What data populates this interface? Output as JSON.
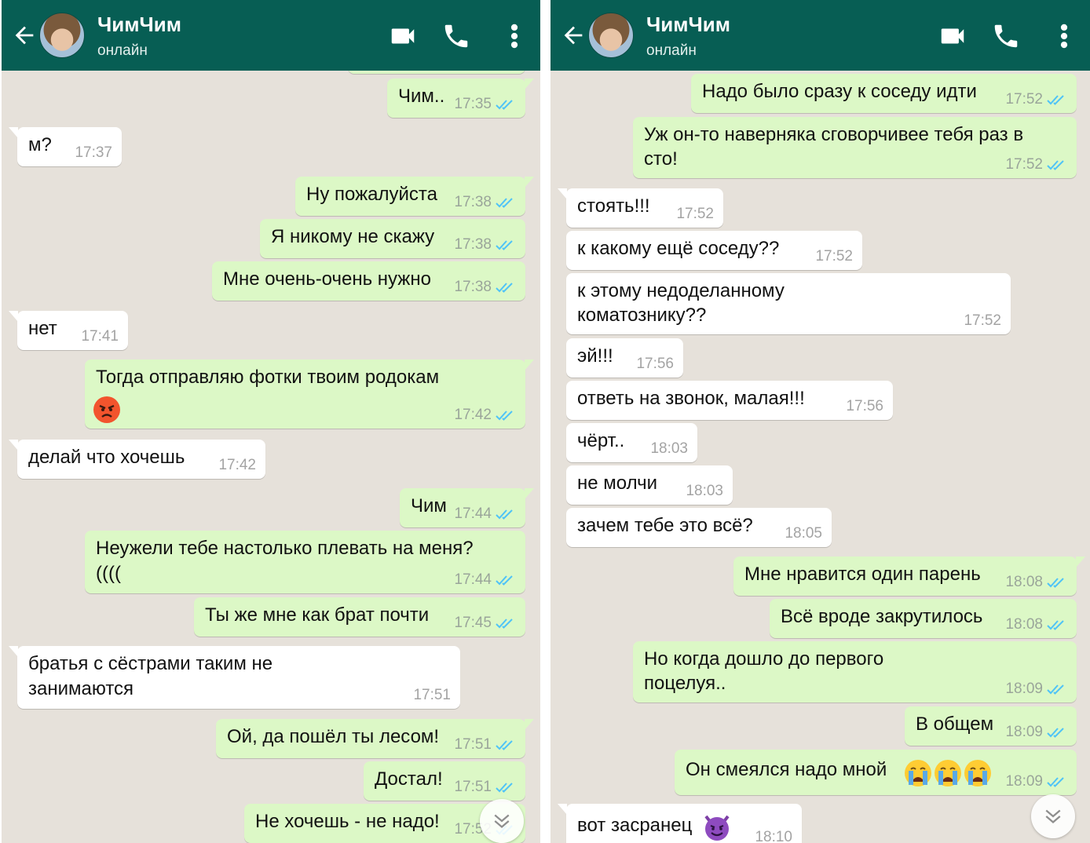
{
  "contact": {
    "name": "ЧимЧим",
    "status": "онлайн"
  },
  "left_messages": [
    {
      "dir": "out",
      "text": "Чим..",
      "time": "17:35"
    },
    {
      "dir": "in",
      "text": "м?",
      "time": "17:37"
    },
    {
      "dir": "out",
      "text": "Ну пожалуйста",
      "time": "17:38"
    },
    {
      "dir": "out",
      "text": "Я никому не скажу",
      "time": "17:38"
    },
    {
      "dir": "out",
      "text": "Мне очень-очень нужно",
      "time": "17:38"
    },
    {
      "dir": "in",
      "text": "нет",
      "time": "17:41"
    },
    {
      "dir": "out",
      "text": "Тогда отправляю фотки твоим родокам",
      "emoji": "angry-face",
      "time": "17:42"
    },
    {
      "dir": "in",
      "text": "делай что хочешь",
      "time": "17:42"
    },
    {
      "dir": "out",
      "text": "Чим",
      "time": "17:44"
    },
    {
      "dir": "out",
      "text": "Неужели тебе настолько плевать на меня?",
      "text2": "((((",
      "time": "17:44"
    },
    {
      "dir": "out",
      "text": "Ты же мне как брат почти",
      "time": "17:45"
    },
    {
      "dir": "in",
      "text": "братья с сёстрами таким не",
      "text2": "занимаются",
      "time": "17:51"
    },
    {
      "dir": "out",
      "text": "Ой, да пошёл ты лесом!",
      "time": "17:51"
    },
    {
      "dir": "out",
      "text": "Достал!",
      "time": "17:51"
    },
    {
      "dir": "out",
      "text": "Не хочешь - не надо!",
      "time": "17:52"
    }
  ],
  "right_messages": [
    {
      "dir": "out",
      "text": "Надо было сразу к соседу идти",
      "time": "17:52"
    },
    {
      "dir": "out",
      "text": "Уж он-то наверняка сговорчивее тебя раз в",
      "text2": "сто!",
      "time": "17:52"
    },
    {
      "dir": "in",
      "text": "стоять!!!",
      "time": "17:52"
    },
    {
      "dir": "in",
      "text": "к какому ещё соседу??",
      "time": "17:52"
    },
    {
      "dir": "in",
      "text": "к этому недоделанному",
      "text2": "коматознику??",
      "time": "17:52"
    },
    {
      "dir": "in",
      "text": "эй!!!",
      "time": "17:56"
    },
    {
      "dir": "in",
      "text": "ответь на звонок, малая!!!",
      "time": "17:56"
    },
    {
      "dir": "in",
      "text": "чёрт..",
      "time": "18:03"
    },
    {
      "dir": "in",
      "text": "не молчи",
      "time": "18:03"
    },
    {
      "dir": "in",
      "text": "зачем тебе это всё?",
      "time": "18:05"
    },
    {
      "dir": "out",
      "text": "Мне нравится один парень",
      "time": "18:08"
    },
    {
      "dir": "out",
      "text": "Всё вроде закрутилось",
      "time": "18:08"
    },
    {
      "dir": "out",
      "text": "Но когда дошло до первого",
      "text2": "поцелуя..",
      "time": "18:09"
    },
    {
      "dir": "out",
      "text": "В общем",
      "time": "18:09"
    },
    {
      "dir": "out",
      "text": "Он смеялся надо мной",
      "emoji_inline": [
        "crying-face",
        "crying-face",
        "crying-face"
      ],
      "time": "18:09"
    },
    {
      "dir": "in",
      "text": "вот засранец",
      "emoji_inline": [
        "smiling-devil-face"
      ],
      "time": "18:10"
    }
  ],
  "colors": {
    "header": "#075e54",
    "outgoing_bubble": "#dcf8c6",
    "incoming_bubble": "#ffffff",
    "chat_background": "#e6e1da",
    "read_ticks": "#4fc3f7"
  },
  "icons": [
    "back-arrow-icon",
    "video-call-icon",
    "phone-icon",
    "more-vert-icon",
    "double-check-icon",
    "chevron-double-down-icon"
  ]
}
